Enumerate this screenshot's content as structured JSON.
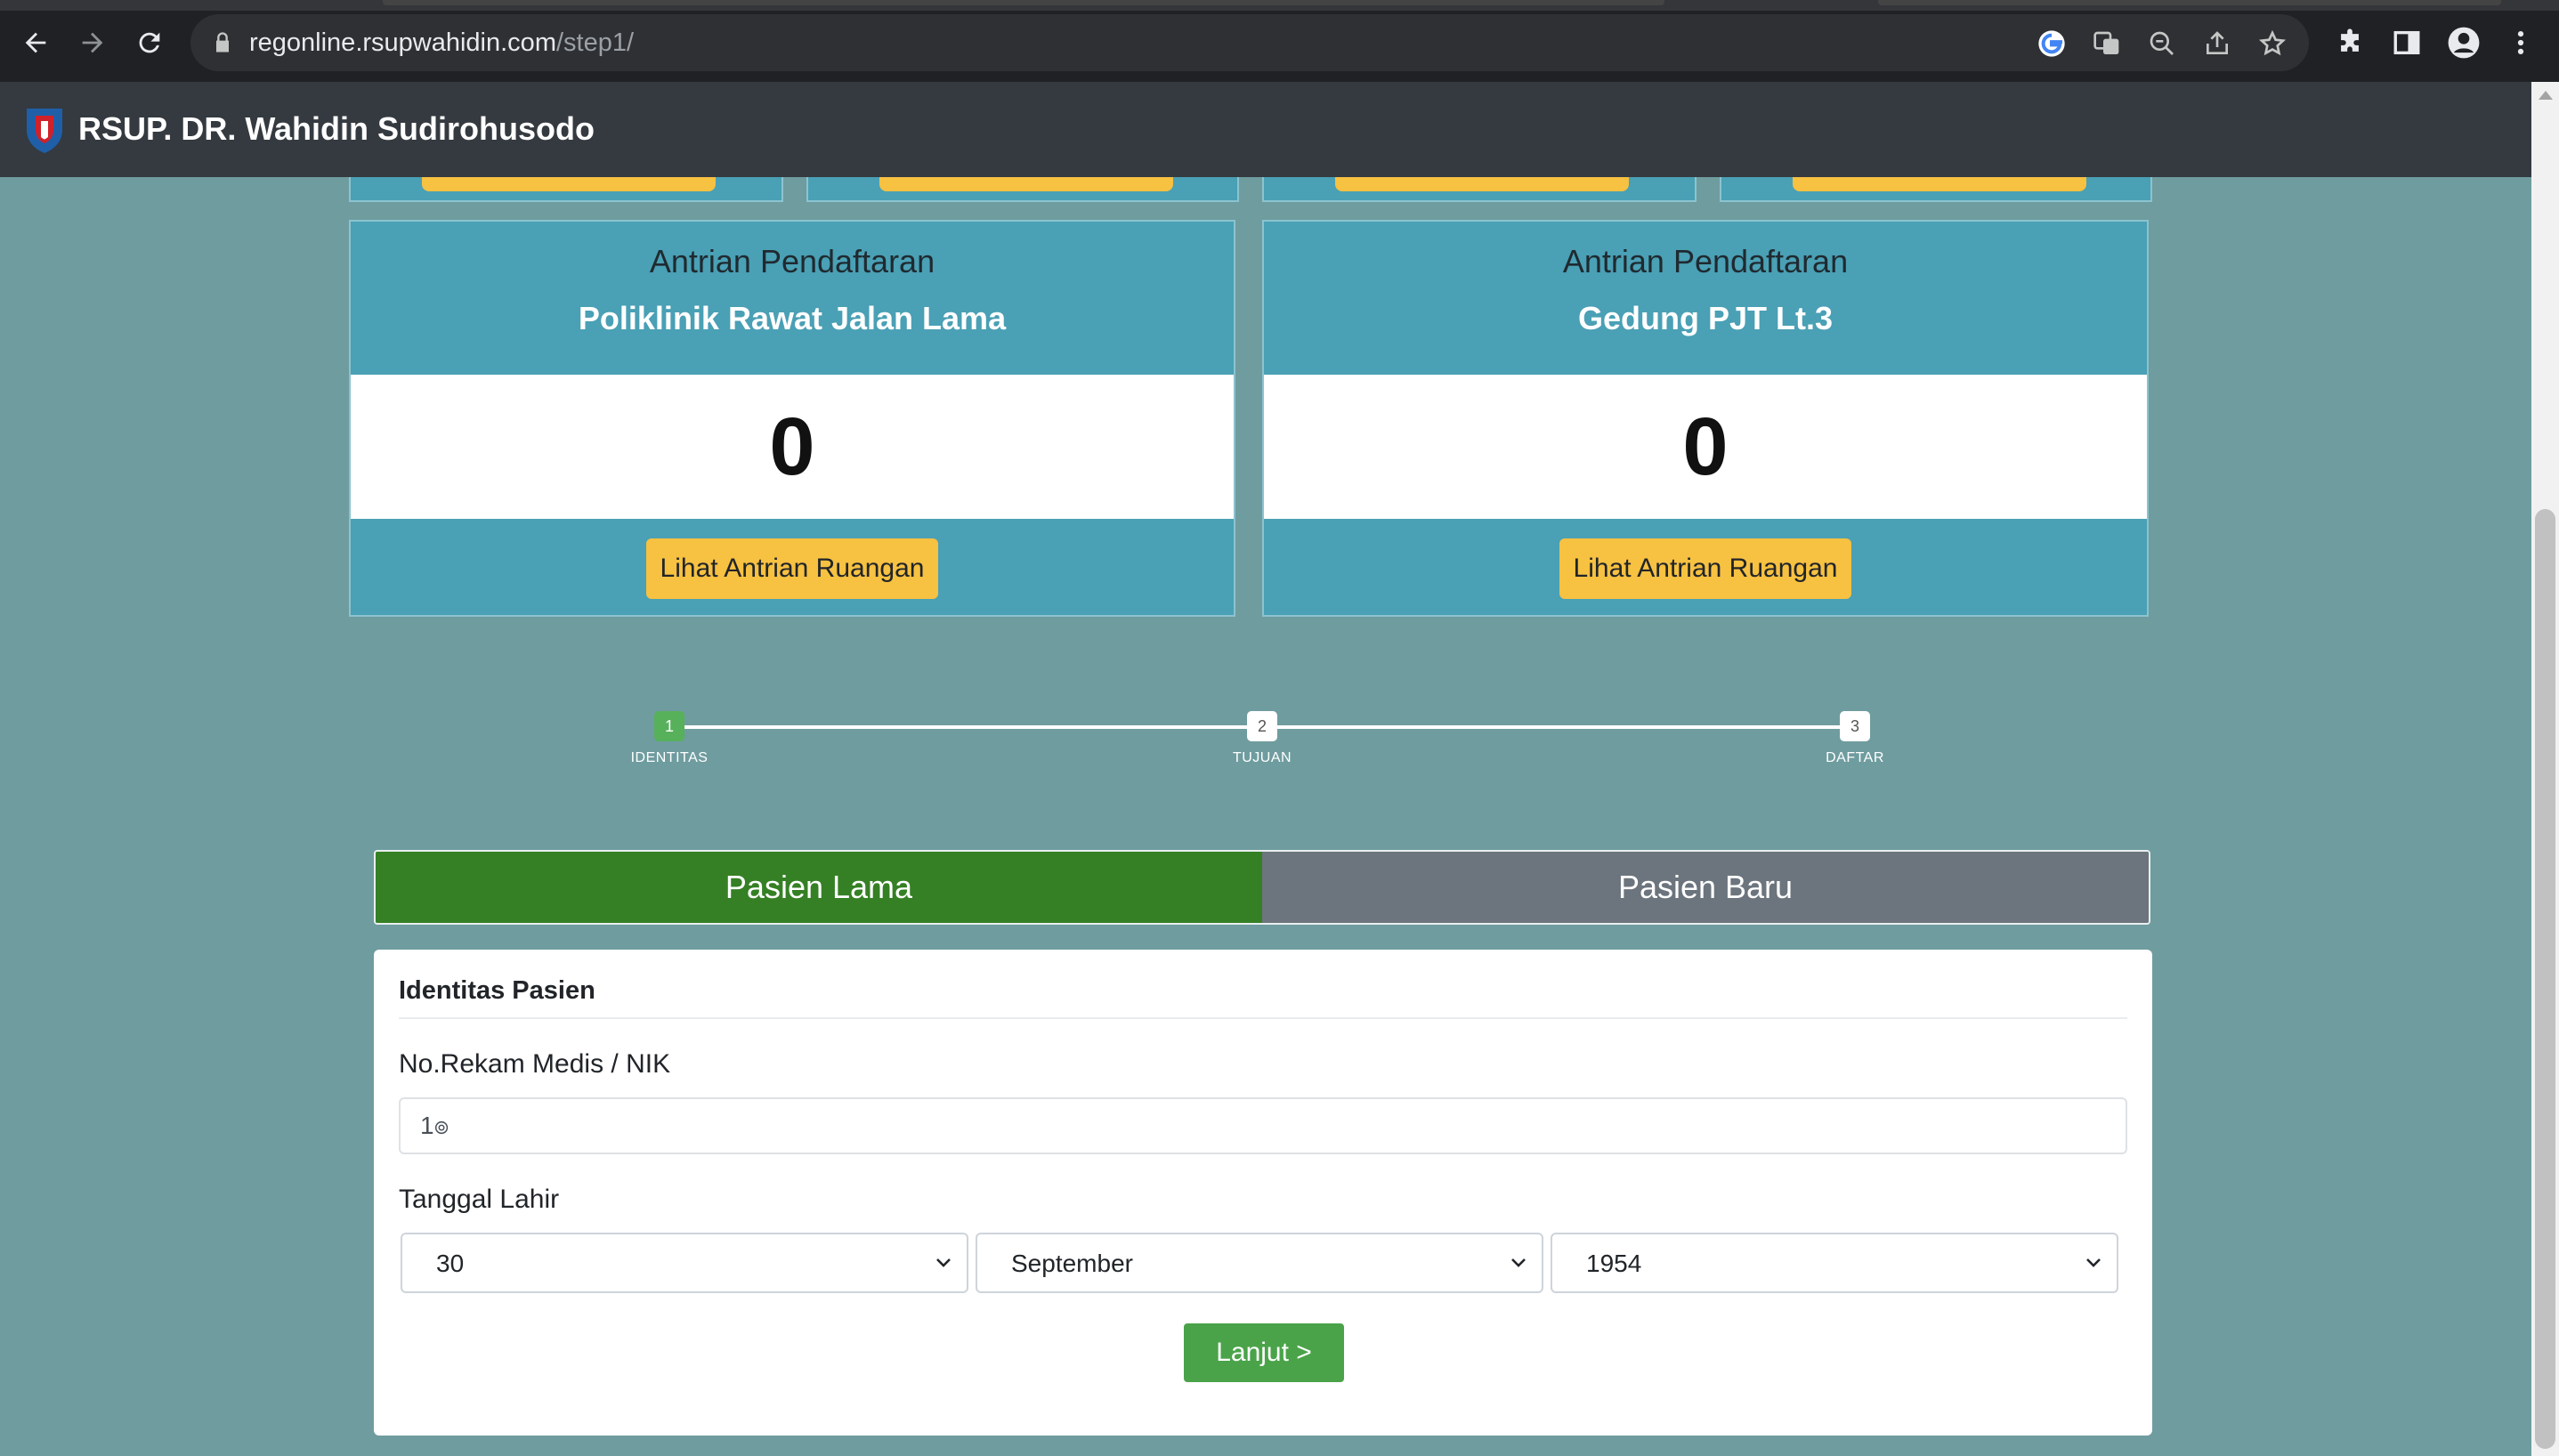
{
  "browser": {
    "url_host": "regonline.rsupwahidin.com",
    "url_path": "/step1/"
  },
  "navbar": {
    "brand": "RSUP. DR. Wahidin Sudirohusodo"
  },
  "queues": [
    {
      "title": "Antrian Pendaftaran",
      "subtitle": "Poliklinik Rawat Jalan Lama",
      "count": "0",
      "button": "Lihat Antrian Ruangan"
    },
    {
      "title": "Antrian Pendaftaran",
      "subtitle": "Gedung PJT Lt.3",
      "count": "0",
      "button": "Lihat Antrian Ruangan"
    }
  ],
  "stepper": {
    "steps": [
      {
        "number": "1",
        "label": "IDENTITAS",
        "active": true
      },
      {
        "number": "2",
        "label": "TUJUAN",
        "active": false
      },
      {
        "number": "3",
        "label": "DAFTAR",
        "active": false
      }
    ]
  },
  "tabs": {
    "active": "Pasien Lama",
    "inactive": "Pasien Baru"
  },
  "form": {
    "section_title": "Identitas Pasien",
    "record_label": "No.Rekam Medis / NIK",
    "record_value": "1๏",
    "dob_label": "Tanggal Lahir",
    "day": "30",
    "month": "September",
    "year": "1954",
    "submit": "Lanjut >"
  },
  "colors": {
    "background": "#6f9c9f",
    "card": "#4aa0b5",
    "accent_yellow": "#f7c141",
    "tab_active": "#358024",
    "tab_inactive": "#6c757d",
    "submit": "#4aa349"
  }
}
